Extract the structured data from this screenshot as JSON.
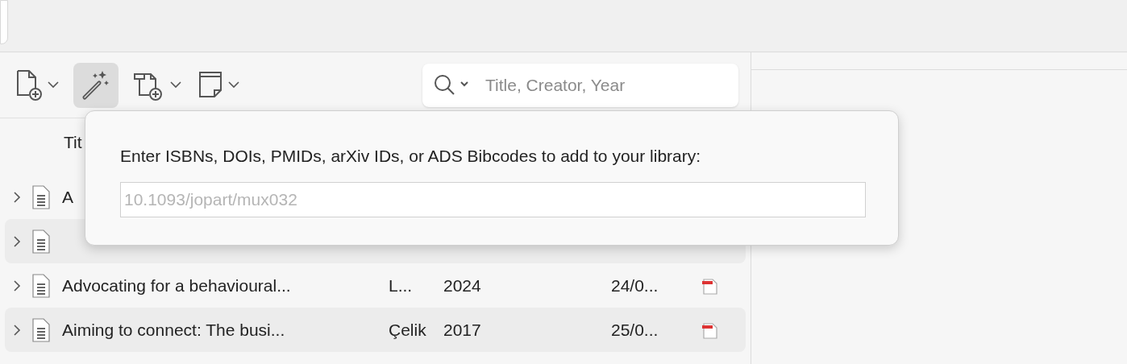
{
  "toolbar": {
    "buttons": [
      {
        "kind": "new-item",
        "selected": false,
        "menu": true
      },
      {
        "kind": "wand",
        "selected": true,
        "menu": false
      },
      {
        "kind": "attachment",
        "selected": false,
        "menu": true
      },
      {
        "kind": "note",
        "selected": false,
        "menu": true
      }
    ]
  },
  "search": {
    "placeholder": "Title, Creator, Year"
  },
  "table": {
    "columns": [
      "Tit"
    ],
    "rows": [
      {
        "title": "A",
        "creator": "",
        "year": "",
        "added": "",
        "pdf": false
      },
      {
        "title": "",
        "creator": "",
        "year": "",
        "added": "",
        "pdf": false
      },
      {
        "title": "Advocating for a behavioural...",
        "creator": "L...",
        "year": "2024",
        "added": "24/0...",
        "pdf": true
      },
      {
        "title": "Aiming to connect: The busi...",
        "creator": "Çelik",
        "year": "2017",
        "added": "25/0...",
        "pdf": true
      }
    ]
  },
  "popup": {
    "label": "Enter ISBNs, DOIs, PMIDs, arXiv IDs, or ADS Bibcodes to add to your library:",
    "placeholder": "10.1093/jopart/mux032"
  }
}
